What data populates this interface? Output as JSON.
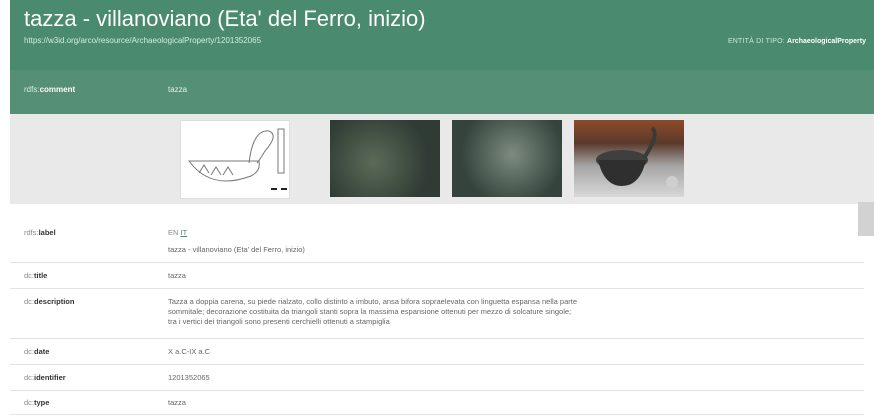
{
  "header": {
    "title": "tazza - villanoviano (Eta' del Ferro, inizio)",
    "uri": "https://w3id.org/arco/resource/ArchaeologicalProperty/1201352065",
    "entity_prefix": "ENTITÀ DI TIPO:",
    "entity_type": "ArchaeologicalProperty"
  },
  "comment": {
    "prefix": "rdfs:",
    "key": "comment",
    "value": "tazza"
  },
  "gallery": {
    "images": [
      {
        "icon": "drawing-image"
      },
      {
        "icon": "photo-image"
      },
      {
        "icon": "photo-image"
      },
      {
        "icon": "photo-image"
      }
    ]
  },
  "properties": [
    {
      "prefix": "rdfs:",
      "key": "label",
      "lang_en": "EN",
      "lang_it": "IT",
      "value": "tazza - villanoviano (Eta' del Ferro, inizio)"
    },
    {
      "prefix": "dc:",
      "key": "title",
      "value": "tazza"
    },
    {
      "prefix": "dc:",
      "key": "description",
      "lines": [
        "Tazza a doppia carena, su piede rialzato, collo distinto a imbuto, ansa bifora sopraelevata con linguetta espansa nella parte",
        "sommitale; decorazione costituita da triangoli stanti sopra la massima espansione ottenuti per mezzo di solcature singole;",
        "tra i vertici dei triangoli sono presenti cerchielli ottenuti a stampiglia"
      ]
    },
    {
      "prefix": "dc:",
      "key": "date",
      "value": "X a.C-IX a.C"
    },
    {
      "prefix": "dc:",
      "key": "identifier",
      "value": "1201352065"
    },
    {
      "prefix": "dc:",
      "key": "type",
      "value": "tazza"
    }
  ],
  "colors": {
    "header": "#4a8a6e",
    "comment_row": "#558f75",
    "gallery_bg": "#e9e9e9"
  }
}
